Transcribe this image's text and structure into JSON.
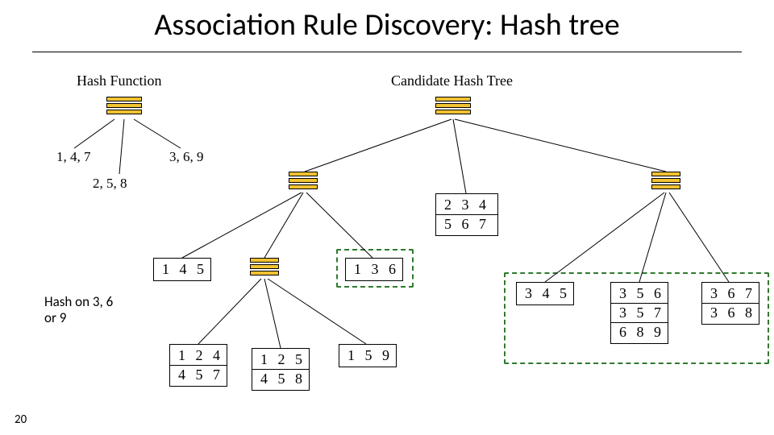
{
  "slide": {
    "title": "Association Rule Discovery: Hash tree",
    "number": "20"
  },
  "labels": {
    "hash_function": "Hash Function",
    "candidate_tree": "Candidate Hash Tree",
    "branch_left": "1, 4, 7",
    "branch_mid": "2, 5, 8",
    "branch_right": "3, 6, 9",
    "note_l1": "Hash on 3, 6",
    "note_l2": "or 9"
  },
  "leaves": {
    "n234_567": [
      "2 3 4",
      "5 6 7"
    ],
    "n145": [
      "1 4 5"
    ],
    "n136": [
      "1 3 6"
    ],
    "n345": [
      "3 4 5"
    ],
    "n356_357_689": [
      "3 5 6",
      "3 5 7",
      "6 8 9"
    ],
    "n367_368": [
      "3 6 7",
      "3 6 8"
    ],
    "n124_457": [
      "1 2 4",
      "4 5 7"
    ],
    "n125_458": [
      "1 2 5",
      "4 5 8"
    ],
    "n159": [
      "1 5 9"
    ]
  }
}
